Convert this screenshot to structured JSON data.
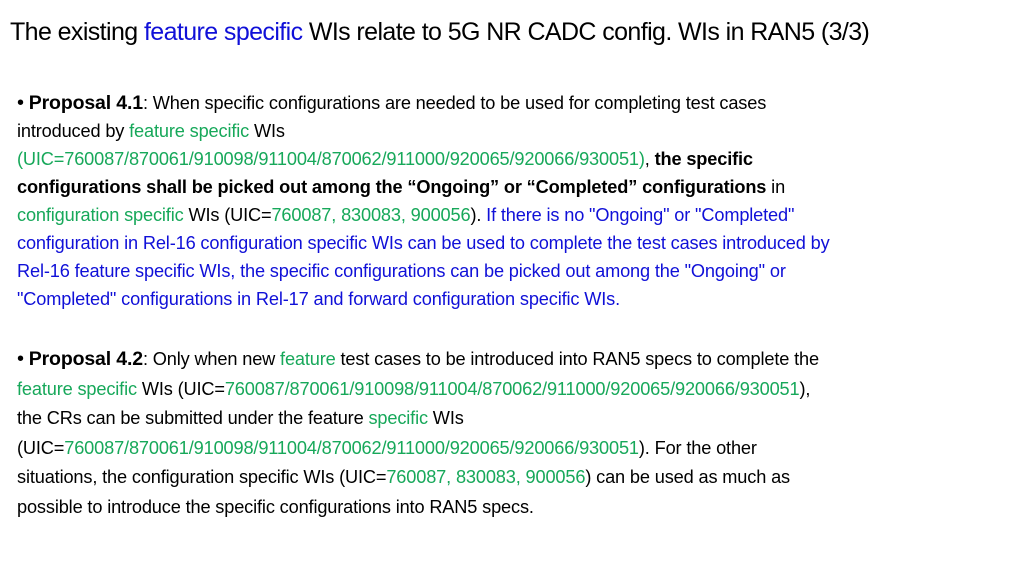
{
  "title": {
    "pre": "The existing ",
    "highlight": "feature specific",
    "post": " WIs relate to 5G NR CADC config. WIs in RAN5 (3/3)"
  },
  "colors": {
    "blue": "#1010d8",
    "green": "#17a85a",
    "text": "#000000"
  },
  "bullet_icon": "•",
  "proposal_1": {
    "label": "Proposal 4.1",
    "lines": [
      [
        {
          "t": ": When specific configurations are needed to be used for completing test cases",
          "c": ""
        }
      ],
      [
        {
          "t": "introduced by ",
          "c": ""
        },
        {
          "t": "feature specific",
          "c": "green"
        },
        {
          "t": " WIs",
          "c": ""
        }
      ],
      [
        {
          "t": "(UIC=760087/870061/910098/911004/870062/911000/920065/920066/930051)",
          "c": "green"
        },
        {
          "t": ", ",
          "c": ""
        },
        {
          "t": "the specific",
          "c": "b"
        }
      ],
      [
        {
          "t": "configurations shall be picked out among the “Ongoing” or “Completed” configurations",
          "c": "b"
        },
        {
          "t": " in",
          "c": ""
        }
      ],
      [
        {
          "t": "configuration specific",
          "c": "green"
        },
        {
          "t": " WIs (UIC=",
          "c": ""
        },
        {
          "t": "760087, 830083, 900056",
          "c": "green"
        },
        {
          "t": ").  ",
          "c": ""
        },
        {
          "t": "If there is no \"Ongoing\" or \"Completed\"",
          "c": "blue"
        }
      ],
      [
        {
          "t": "configuration in Rel-16 configuration specific WIs can be used to complete the test cases introduced by",
          "c": "blue"
        }
      ],
      [
        {
          "t": "Rel-16 feature specific WIs, the specific configurations can be picked out among the \"Ongoing\" or",
          "c": "blue"
        }
      ],
      [
        {
          "t": "\"Completed\" configurations in Rel-17 and forward configuration specific WIs.",
          "c": "blue"
        }
      ]
    ]
  },
  "proposal_2": {
    "label": "Proposal 4.2",
    "lines": [
      [
        {
          "t": ": Only when new ",
          "c": ""
        },
        {
          "t": "feature",
          "c": "green"
        },
        {
          "t": " test cases to be introduced into RAN5 specs to complete the",
          "c": ""
        }
      ],
      [
        {
          "t": "feature specific",
          "c": "green"
        },
        {
          "t": " WIs (UIC=",
          "c": ""
        },
        {
          "t": "760087/870061/910098/911004/870062/911000/920065/920066/930051",
          "c": "green"
        },
        {
          "t": "),",
          "c": ""
        }
      ],
      [
        {
          "t": "the CRs can be submitted under the feature ",
          "c": ""
        },
        {
          "t": "specific",
          "c": "green"
        },
        {
          "t": " WIs",
          "c": ""
        }
      ],
      [
        {
          "t": "(UIC=",
          "c": ""
        },
        {
          "t": "760087/870061/910098/911004/870062/911000/920065/920066/930051",
          "c": "green"
        },
        {
          "t": "). For the other",
          "c": ""
        }
      ],
      [
        {
          "t": "situations, the configuration specific WIs (UIC=",
          "c": ""
        },
        {
          "t": "760087, 830083, 900056",
          "c": "green"
        },
        {
          "t": ") can be used as much as",
          "c": ""
        }
      ],
      [
        {
          "t": "possible to introduce the specific configurations into RAN5 specs.",
          "c": ""
        }
      ]
    ]
  }
}
